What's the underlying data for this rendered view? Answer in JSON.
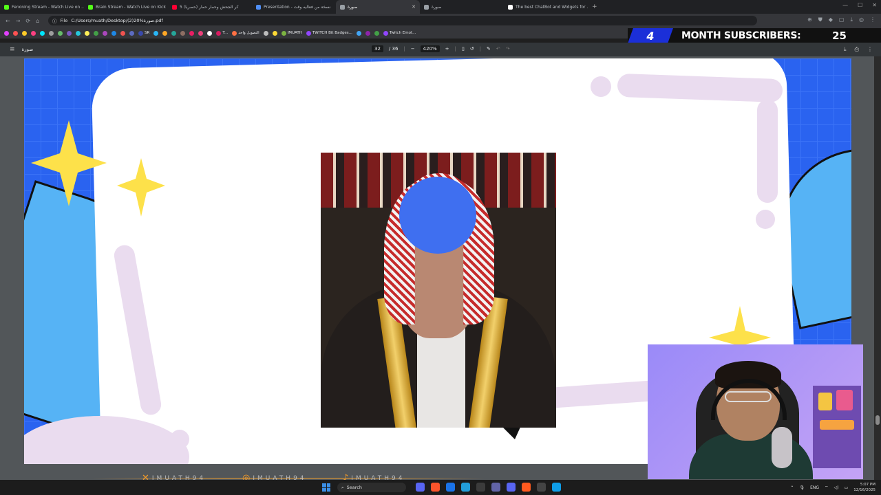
{
  "tabs": [
    {
      "title": "Fenoning Stream - Watch Live on ...",
      "color": "#53fc18"
    },
    {
      "title": "Brain Stream - Watch Live on Kick",
      "color": "#53fc18"
    },
    {
      "title": "كر الجحش وحمار حمار (حصريا) 5",
      "color": "#ff0033"
    },
    {
      "title": "Presentation - نسخة من فعاليه وقت",
      "color": "#4f8ff7"
    },
    {
      "title": "صورة",
      "color": "#9aa0a6",
      "active": true
    },
    {
      "title": "صورة",
      "color": "#9aa0a6"
    },
    {
      "title": "The best ChatBot and Widgets for ...",
      "color": "#ffffff"
    }
  ],
  "address": {
    "scheme": "File",
    "url": "C:/Users/muath/Desktop/(2)20%صورة.pdf"
  },
  "bookmarks": [
    {
      "label": "",
      "color": "#e040fb"
    },
    {
      "label": "",
      "color": "#ff5252"
    },
    {
      "label": "",
      "color": "#ffca28"
    },
    {
      "label": "",
      "color": "#ff4081"
    },
    {
      "label": "",
      "color": "#00e5ff"
    },
    {
      "label": "",
      "color": "#9e9e9e"
    },
    {
      "label": "",
      "color": "#66bb6a"
    },
    {
      "label": "",
      "color": "#7e57c2"
    },
    {
      "label": "",
      "color": "#26c6da"
    },
    {
      "label": "",
      "color": "#ffee58"
    },
    {
      "label": "",
      "color": "#43a047"
    },
    {
      "label": "",
      "color": "#ab47bc"
    },
    {
      "label": "",
      "color": "#1e88e5"
    },
    {
      "label": "",
      "color": "#ef5350"
    },
    {
      "label": "",
      "color": "#5c6bc0"
    },
    {
      "label": "SR",
      "color": "#3949ab"
    },
    {
      "label": "",
      "color": "#29b6f6"
    },
    {
      "label": "",
      "color": "#ffa726"
    },
    {
      "label": "",
      "color": "#26a69a"
    },
    {
      "label": "",
      "color": "#8d6e63"
    },
    {
      "label": "",
      "color": "#e91e63"
    },
    {
      "label": "",
      "color": "#ec407a"
    },
    {
      "label": "",
      "color": "#fff"
    },
    {
      "label": "T...",
      "color": "#d81b60"
    },
    {
      "label": "التصويل واحد",
      "color": "#ff7043"
    },
    {
      "label": "",
      "color": "#bdbdbd"
    },
    {
      "label": "",
      "color": "#fdd835"
    },
    {
      "label": "IMUATH",
      "color": "#7cb342"
    },
    {
      "label": "TWITCH Bit Badges...",
      "color": "#9146ff"
    },
    {
      "label": "",
      "color": "#42a5f5"
    },
    {
      "label": "",
      "color": "#8e24aa"
    },
    {
      "label": "",
      "color": "#43a047"
    },
    {
      "label": "Twitch Emot...",
      "color": "#9146ff"
    }
  ],
  "sub_banner": {
    "count": "4",
    "label": "MONTH SUBSCRIBERS:",
    "value": "25"
  },
  "pdf": {
    "title": "صورة",
    "page": "32",
    "total": "/ 36",
    "zoom": "420%"
  },
  "social": {
    "handles": [
      "IMUATH94",
      "IMUATH94",
      "IMUATH94"
    ]
  },
  "taskbar": {
    "search": "Search",
    "lang": "ENG",
    "time": "5:07 PM",
    "date": "12/16/2025"
  }
}
